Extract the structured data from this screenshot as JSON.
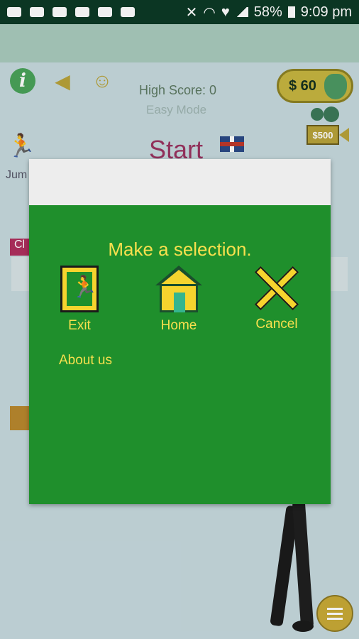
{
  "status_bar": {
    "battery": "58%",
    "time": "9:09 pm"
  },
  "game": {
    "high_score_label": "High Score: 0",
    "mode": "Easy Mode",
    "money": "$ 60",
    "video_reward": "$500",
    "start_label": "Start",
    "jump_label": "Jum",
    "badge": "Cl"
  },
  "dialog": {
    "title": "Make a selection.",
    "options": [
      {
        "label": "Exit"
      },
      {
        "label": "Home"
      },
      {
        "label": "Cancel"
      }
    ],
    "about": "About us"
  },
  "colors": {
    "dialog_bg": "#1f8f2c",
    "accent_yellow": "#f8e04e",
    "status_bar": "#0c3a26"
  }
}
